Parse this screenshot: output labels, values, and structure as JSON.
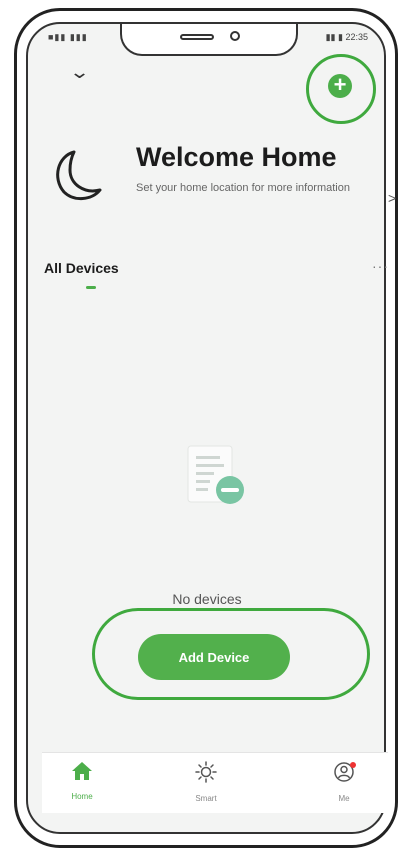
{
  "status": {
    "left": "■▮▮ ▮▮▮",
    "right": "▮▮ ▮ 22:35"
  },
  "header": {
    "add_icon": "plus-circle-icon",
    "dropdown_icon": "chevron-down-icon"
  },
  "welcome": {
    "title": "Welcome Home",
    "subtitle": "Set your home location for more information",
    "arrow": ">"
  },
  "devices": {
    "tab_label": "All Devices",
    "more": "···",
    "empty_text": "No devices",
    "add_button_label": "Add Device"
  },
  "bottom_nav": {
    "items": [
      {
        "label": "Home",
        "icon": "home-icon",
        "active": true
      },
      {
        "label": "Smart",
        "icon": "sun-icon",
        "active": false
      },
      {
        "label": "Me",
        "icon": "user-icon",
        "active": false
      }
    ]
  },
  "colors": {
    "accent": "#4cae4a",
    "highlight": "#3fa93e"
  }
}
